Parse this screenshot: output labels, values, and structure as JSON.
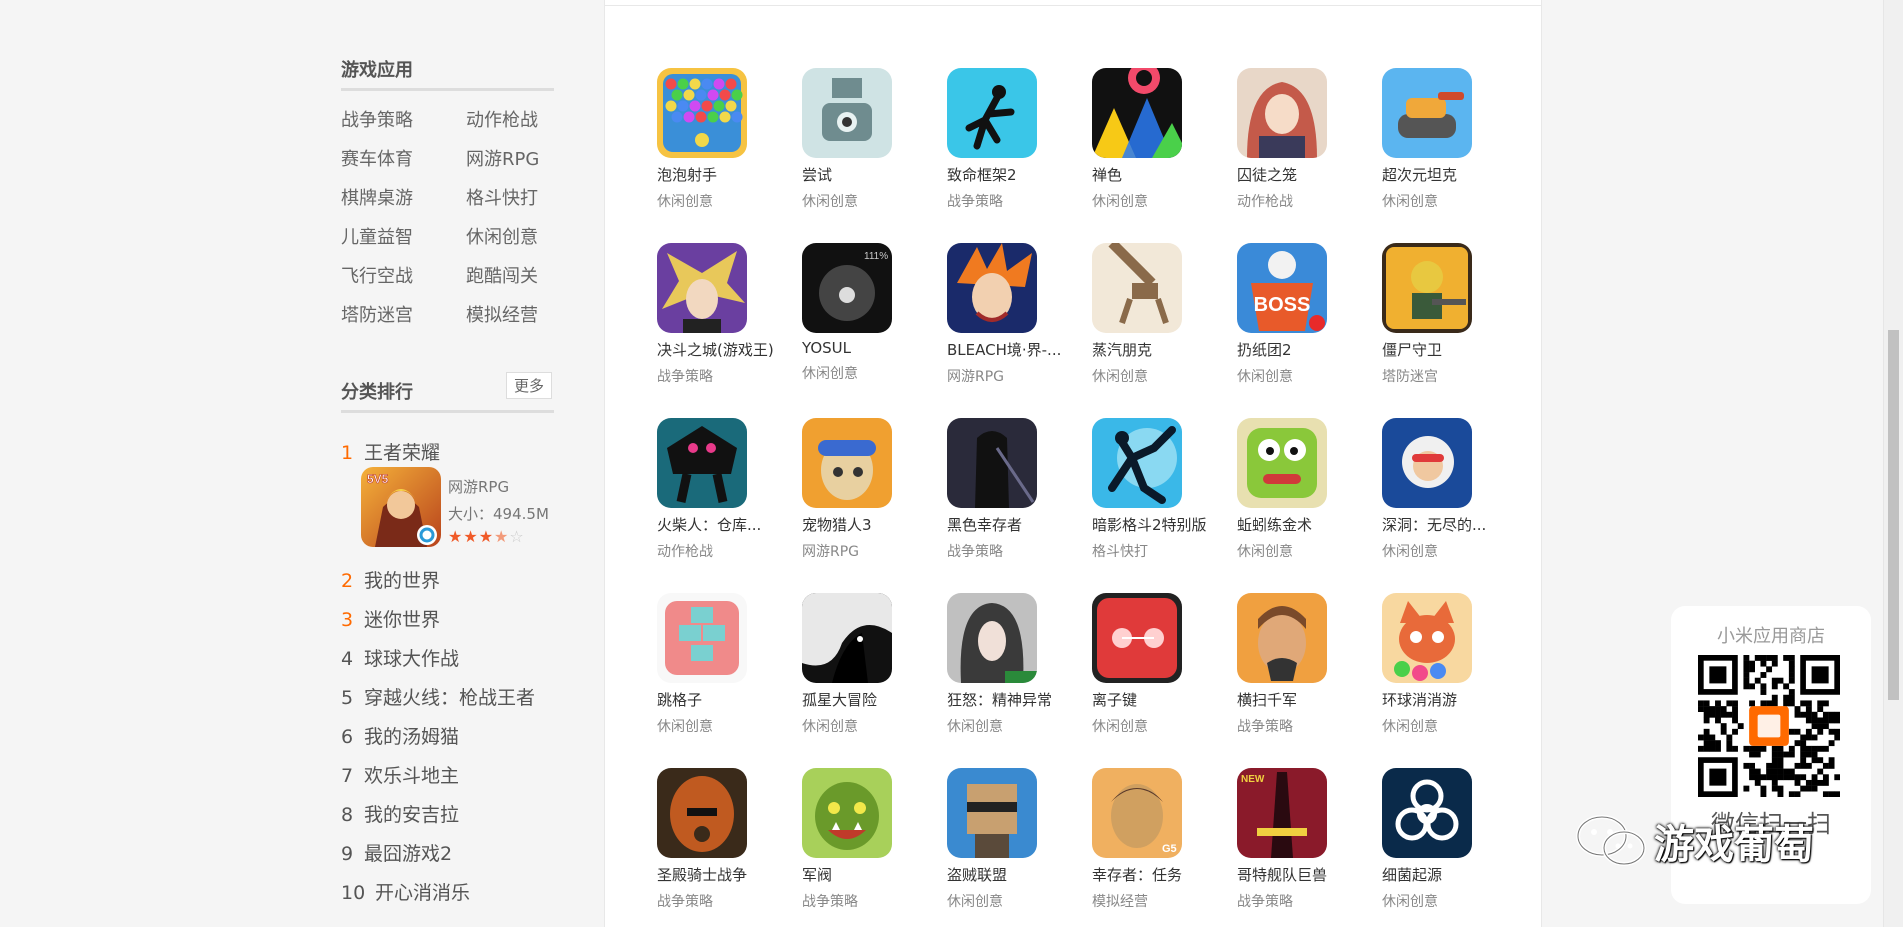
{
  "sidebar": {
    "categories_title": "游戏应用",
    "categories": [
      "战争策略",
      "动作枪战",
      "赛车体育",
      "网游RPG",
      "棋牌桌游",
      "格斗快打",
      "儿童益智",
      "休闲创意",
      "飞行空战",
      "跑酷闯关",
      "塔防迷宫",
      "模拟经营"
    ],
    "ranking_title": "分类排行",
    "more_label": "更多",
    "ranking": [
      {
        "rank": "1",
        "name": "王者荣耀"
      },
      {
        "rank": "2",
        "name": "我的世界"
      },
      {
        "rank": "3",
        "name": "迷你世界"
      },
      {
        "rank": "4",
        "name": "球球大作战"
      },
      {
        "rank": "5",
        "name": "穿越火线：枪战王者"
      },
      {
        "rank": "6",
        "name": "我的汤姆猫"
      },
      {
        "rank": "7",
        "name": "欢乐斗地主"
      },
      {
        "rank": "8",
        "name": "我的安吉拉"
      },
      {
        "rank": "9",
        "name": "最囧游戏2"
      },
      {
        "rank": "10",
        "name": "开心消消乐"
      }
    ],
    "featured": {
      "category": "网游RPG",
      "size": "大小：494.5M",
      "rating": 3.5,
      "icon_badge": "5V5"
    }
  },
  "apps": [
    [
      {
        "name": "泡泡射手",
        "category": "休闲创意",
        "icon": "bubble-shooter-icon",
        "colors": [
          "#f6c342",
          "#3a8fd8"
        ]
      },
      {
        "name": "尝试",
        "category": "休闲创意",
        "icon": "robot-claw-icon",
        "colors": [
          "#cfe3e4",
          "#6f8c8f"
        ]
      },
      {
        "name": "致命框架2",
        "category": "战争策略",
        "icon": "falling-figure-icon",
        "colors": [
          "#3ac6e8",
          "#111111"
        ]
      },
      {
        "name": "禅色",
        "category": "休闲创意",
        "icon": "color-triangles-icon",
        "colors": [
          "#111111",
          "#f7c916"
        ]
      },
      {
        "name": "囚徒之笼",
        "category": "动作枪战",
        "icon": "anime-girl-icon",
        "colors": [
          "#c45a4a",
          "#e8d7c8"
        ]
      },
      {
        "name": "超次元坦克",
        "category": "休闲创意",
        "icon": "cartoon-tank-icon",
        "colors": [
          "#5bb5f0",
          "#f0a83a"
        ]
      }
    ],
    [
      {
        "name": "决斗之城(游戏王)",
        "category": "战争策略",
        "icon": "duelist-icon",
        "colors": [
          "#6a3fa0",
          "#e8c85a"
        ]
      },
      {
        "name": "YOSUL",
        "category": "休闲创意",
        "icon": "dark-face-icon",
        "colors": [
          "#111111",
          "#444444"
        ]
      },
      {
        "name": "BLEACH境·界-...",
        "category": "网游RPG",
        "icon": "orange-hair-hero-icon",
        "colors": [
          "#1a2a6a",
          "#f07a20"
        ]
      },
      {
        "name": "蒸汽朋克",
        "category": "休闲创意",
        "icon": "mech-arm-icon",
        "colors": [
          "#f2e8d8",
          "#8a6a4a"
        ]
      },
      {
        "name": "扔纸团2",
        "category": "休闲创意",
        "icon": "boss-bin-icon",
        "colors": [
          "#3a8ad8",
          "#e85a2a"
        ]
      },
      {
        "name": "僵尸守卫",
        "category": "塔防迷宫",
        "icon": "zombie-soldier-icon",
        "colors": [
          "#f0b030",
          "#3a5a3a"
        ]
      }
    ],
    [
      {
        "name": "火柴人：仓库...",
        "category": "动作枪战",
        "icon": "shadow-stickman-icon",
        "colors": [
          "#1a6a7a",
          "#e83a8a"
        ]
      },
      {
        "name": "宠物猎人3",
        "category": "网游RPG",
        "icon": "goggle-boy-icon",
        "colors": [
          "#f0a030",
          "#e8d0a0"
        ]
      },
      {
        "name": "黑色幸存者",
        "category": "战争策略",
        "icon": "dark-warrior-icon",
        "colors": [
          "#2a2a3a",
          "#6a6a8a"
        ]
      },
      {
        "name": "暗影格斗2特别版",
        "category": "格斗快打",
        "icon": "shadow-fighter-icon",
        "colors": [
          "#3ab8e8",
          "#0a1a2a"
        ]
      },
      {
        "name": "蚯蚓练金术",
        "category": "休闲创意",
        "icon": "green-face-icon",
        "colors": [
          "#8ac83a",
          "#d03a3a"
        ]
      },
      {
        "name": "深洞：无尽的...",
        "category": "休闲创意",
        "icon": "diver-kid-icon",
        "colors": [
          "#1a4a9a",
          "#f0f0f0"
        ]
      }
    ],
    [
      {
        "name": "跳格子",
        "category": "休闲创意",
        "icon": "hopscotch-icon",
        "colors": [
          "#f08a8a",
          "#7ad0d0"
        ]
      },
      {
        "name": "孤星大冒险",
        "category": "休闲创意",
        "icon": "shadow-creature-icon",
        "colors": [
          "#e8e8e8",
          "#111111"
        ]
      },
      {
        "name": "狂怒：精神异常",
        "category": "休闲创意",
        "icon": "dark-hair-girl-icon",
        "colors": [
          "#3a3a3a",
          "#c0c0c0"
        ]
      },
      {
        "name": "离子键",
        "category": "休闲创意",
        "icon": "red-orb-icon",
        "colors": [
          "#e03a3a",
          "#222222"
        ]
      },
      {
        "name": "横扫千军",
        "category": "战争策略",
        "icon": "warlord-icon",
        "colors": [
          "#f0a040",
          "#7a4a2a"
        ]
      },
      {
        "name": "环球消消游",
        "category": "休闲创意",
        "icon": "cartoon-cat-icon",
        "colors": [
          "#f0c060",
          "#e86a3a"
        ]
      }
    ],
    [
      {
        "name": "圣殿骑士战争",
        "category": "战争策略",
        "icon": "armored-knight-icon",
        "colors": [
          "#c05a20",
          "#3a2a1a"
        ]
      },
      {
        "name": "军阀",
        "category": "战争策略",
        "icon": "orc-warrior-icon",
        "colors": [
          "#6a9a2a",
          "#c03a2a"
        ]
      },
      {
        "name": "盗贼联盟",
        "category": "休闲创意",
        "icon": "voxel-thief-icon",
        "colors": [
          "#3a8ad0",
          "#c8a070"
        ]
      },
      {
        "name": "幸存者：任务",
        "category": "模拟经营",
        "icon": "survivor-man-icon",
        "colors": [
          "#d0a060",
          "#5a3a2a"
        ]
      },
      {
        "name": "哥特舰队巨兽",
        "category": "战争策略",
        "icon": "gothic-ship-icon",
        "colors": [
          "#8a1a2a",
          "#f0d040"
        ]
      },
      {
        "name": "细菌起源",
        "category": "休闲创意",
        "icon": "biohazard-icon",
        "colors": [
          "#0a2a4a",
          "#ffffff"
        ]
      }
    ]
  ],
  "qr": {
    "title": "小米应用商店",
    "subtitle": "微信扫一扫"
  },
  "watermark": "游戏葡萄",
  "colors": {
    "accent": "#ff6a00",
    "star": "#f05a28",
    "background": "#f5f5f5"
  }
}
